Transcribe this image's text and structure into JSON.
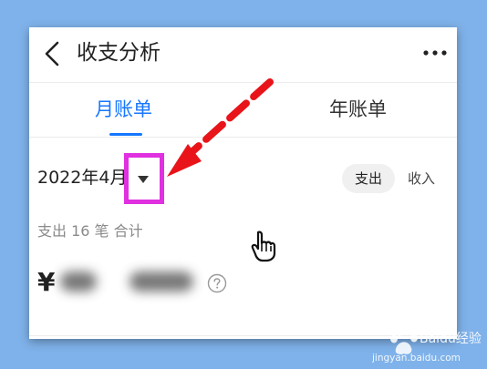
{
  "header": {
    "title": "收支分析",
    "back_icon": "chevron-left-icon",
    "more_icon": "more-dots-icon"
  },
  "tabs": [
    {
      "label": "月账单",
      "active": true
    },
    {
      "label": "年账单",
      "active": false
    }
  ],
  "filter": {
    "date_selected": "2022年4月",
    "type_options": [
      "支出",
      "收入"
    ],
    "type_selected": "支出"
  },
  "summary": {
    "text": "支出 16 笔 合计",
    "currency_symbol": "¥"
  },
  "annotation": {
    "box_color": "#e030e0",
    "arrow_color": "#e8141a"
  },
  "watermark": {
    "brand": "Baidu经验",
    "url": "jingyan.baidu.com"
  },
  "colors": {
    "accent": "#1677ff",
    "background": "#7fb2ea"
  }
}
